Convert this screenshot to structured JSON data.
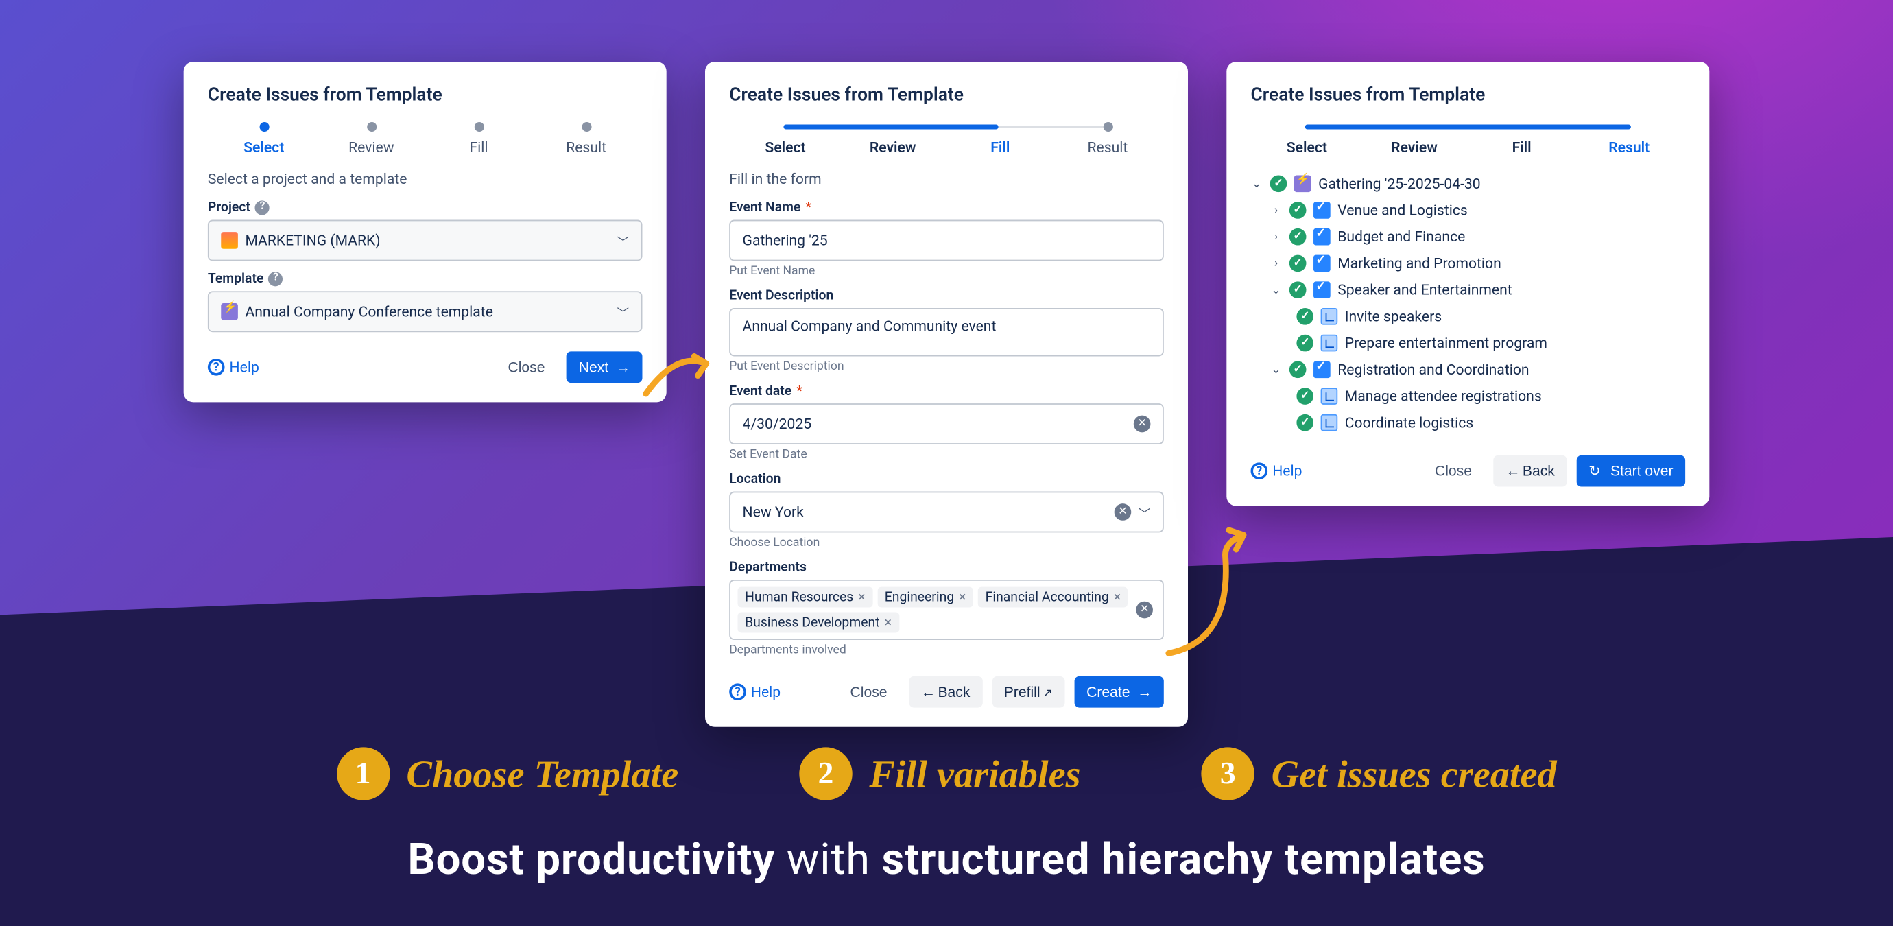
{
  "steps": {
    "select": "Select",
    "review": "Review",
    "fill": "Fill",
    "result": "Result"
  },
  "common": {
    "title": "Create Issues from Template",
    "help": "Help",
    "close": "Close",
    "back": "Back"
  },
  "panel1": {
    "subtitle": "Select a project and a template",
    "project_label": "Project",
    "project_value": "MARKETING (MARK)",
    "template_label": "Template",
    "template_value": "Annual Company Conference template",
    "next": "Next"
  },
  "panel2": {
    "subtitle": "Fill in the form",
    "f1_label": "Event Name",
    "f1_value": "Gathering '25",
    "f1_hint": "Put Event Name",
    "f2_label": "Event Description",
    "f2_value": "Annual Company and Community event",
    "f2_hint": "Put Event Description",
    "f3_label": "Event date",
    "f3_value": "4/30/2025",
    "f3_hint": "Set Event Date",
    "f4_label": "Location",
    "f4_value": "New York",
    "f4_hint": "Choose Location",
    "f5_label": "Departments",
    "tags": [
      "Human Resources",
      "Engineering",
      "Financial Accounting",
      "Business Development"
    ],
    "f5_hint": "Departments involved",
    "prefill": "Prefill",
    "create": "Create"
  },
  "panel3": {
    "tree": {
      "root": "Gathering '25-2025-04-30",
      "items": [
        {
          "label": "Venue and Logistics",
          "expanded": false
        },
        {
          "label": "Budget and Finance",
          "expanded": false
        },
        {
          "label": "Marketing and Promotion",
          "expanded": false
        },
        {
          "label": "Speaker and Entertainment",
          "expanded": true,
          "children": [
            "Invite speakers",
            "Prepare entertainment program"
          ]
        },
        {
          "label": "Registration and Coordination",
          "expanded": true,
          "children": [
            "Manage attendee registrations",
            "Coordinate logistics"
          ]
        }
      ]
    },
    "start_over": "Start over"
  },
  "callouts": {
    "c1": "Choose Template",
    "c2": "Fill variables",
    "c3": "Get issues created"
  },
  "headline": {
    "pre": "Boost productivity",
    "mid": " with ",
    "post": "structured hierachy templates"
  }
}
